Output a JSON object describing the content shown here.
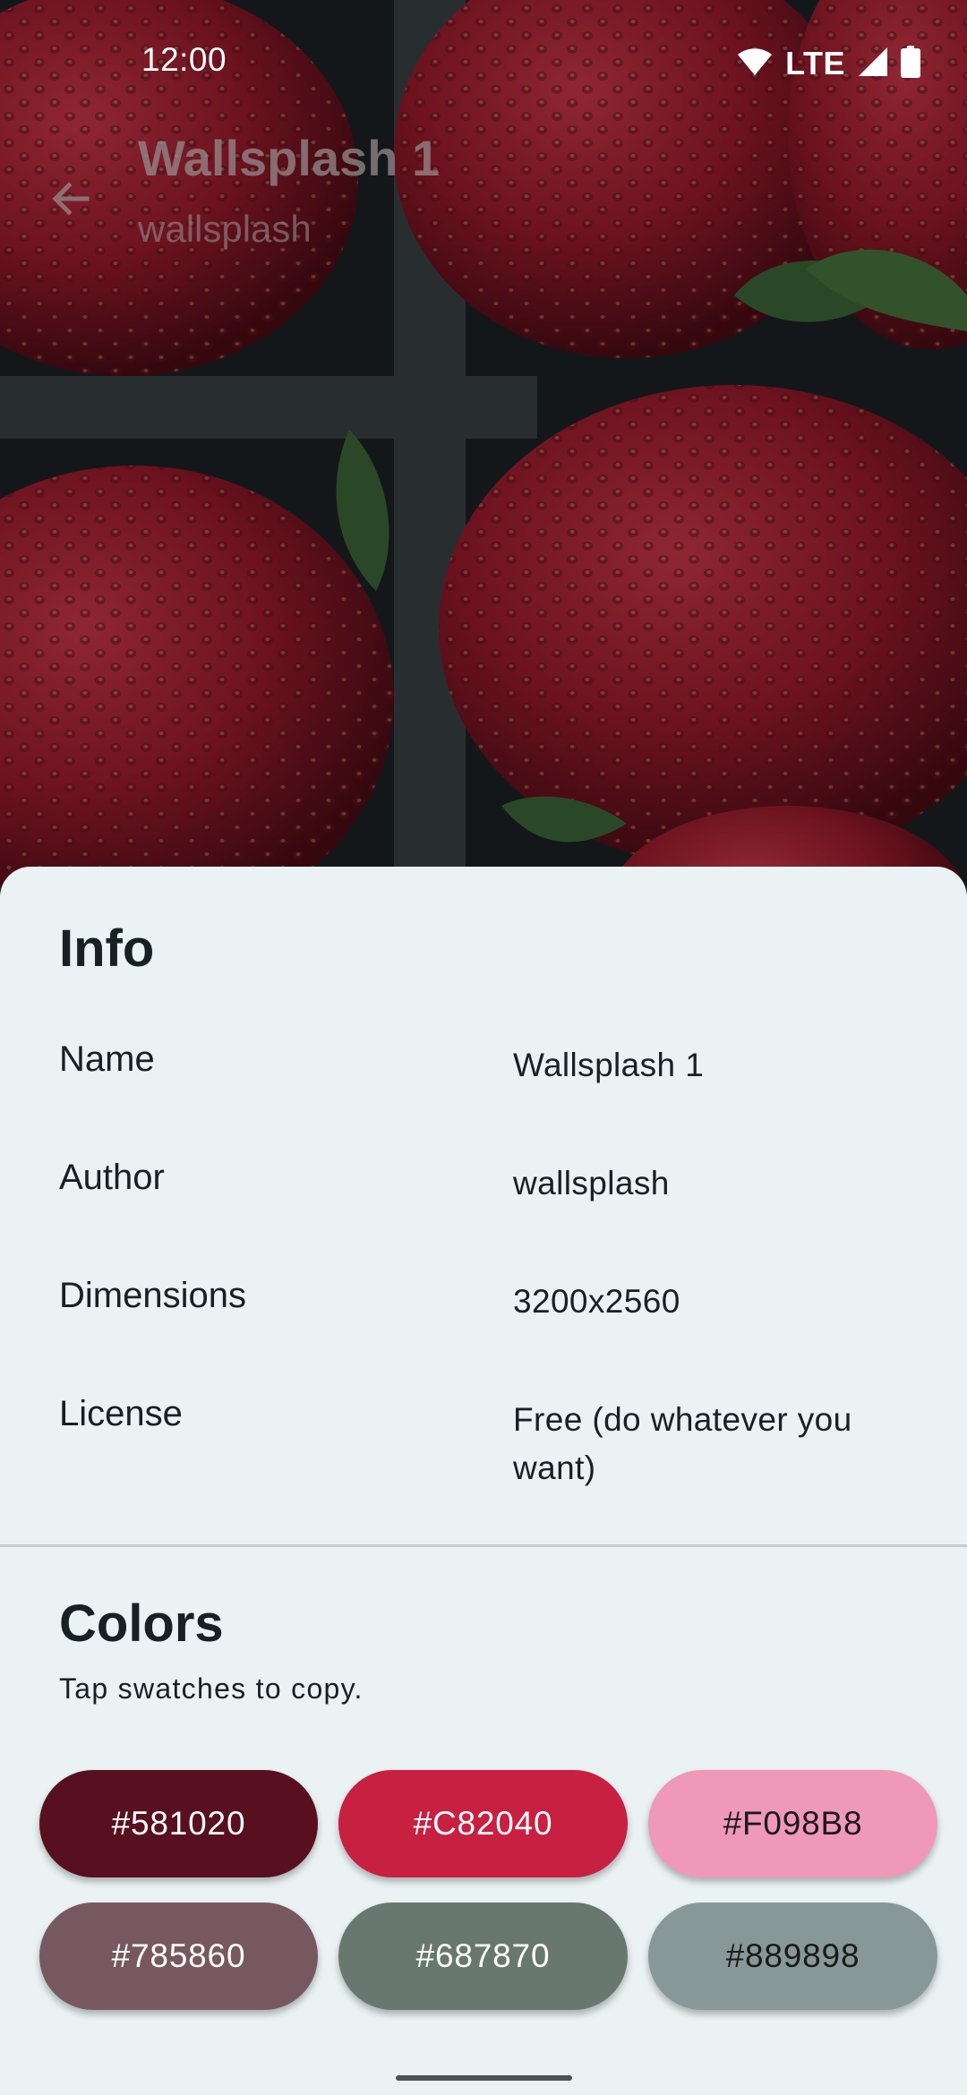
{
  "status_bar": {
    "time": "12:00",
    "network": "LTE",
    "icons": [
      "wifi-icon",
      "cell-signal-icon",
      "battery-icon"
    ]
  },
  "app_bar": {
    "back_icon": "arrow-back-icon",
    "title": "Wallsplash 1",
    "subtitle": "wallsplash"
  },
  "info": {
    "title": "Info",
    "rows": [
      {
        "label": "Name",
        "value": "Wallsplash 1"
      },
      {
        "label": "Author",
        "value": "wallsplash"
      },
      {
        "label": "Dimensions",
        "value": "3200x2560"
      },
      {
        "label": "License",
        "value": "Free (do whatever you want)"
      }
    ]
  },
  "colors": {
    "title": "Colors",
    "hint": "Tap swatches to copy.",
    "swatches": [
      {
        "label": "#581020",
        "color": "#581020",
        "text_color": "#ffffff"
      },
      {
        "label": "#C82040",
        "color": "#C82040",
        "text_color": "#ffffff"
      },
      {
        "label": "#F098B8",
        "color": "#F098B8",
        "text_color": "#1a1a1a"
      },
      {
        "label": "#785860",
        "color": "#785860",
        "text_color": "#ffffff"
      },
      {
        "label": "#687870",
        "color": "#687870",
        "text_color": "#ffffff"
      },
      {
        "label": "#889898",
        "color": "#889898",
        "text_color": "#1a1a1a"
      }
    ]
  },
  "theme": {
    "sheet_background": "#eaf2f3",
    "text_primary": "#172022",
    "wallpaper_subject": "strawberries"
  }
}
